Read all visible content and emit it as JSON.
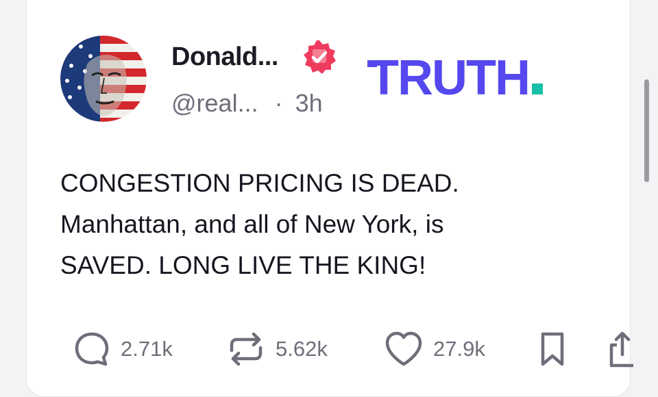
{
  "post": {
    "author": {
      "display_name": "Donald...",
      "handle": "@real...",
      "separator": "·",
      "timestamp": "3h",
      "verified": true
    },
    "brand": {
      "logo_text": "TRUTH",
      "logo_color": "#5448ee",
      "dot_color": "#17c0a7"
    },
    "text": "CONGESTION PRICING IS DEAD.\nManhattan, and all of New York, is\nSAVED. LONG LIVE THE KING!",
    "actions": {
      "replies": {
        "icon": "comment-icon",
        "count": "2.71k"
      },
      "retruths": {
        "icon": "repost-icon",
        "count": "5.62k"
      },
      "likes": {
        "icon": "heart-icon",
        "count": "27.9k"
      },
      "bookmark": {
        "icon": "bookmark-icon"
      },
      "share": {
        "icon": "share-icon"
      }
    }
  },
  "colors": {
    "verified_badge": "#ef3b5d",
    "muted_text": "#6e6e7a",
    "text": "#16161f"
  }
}
